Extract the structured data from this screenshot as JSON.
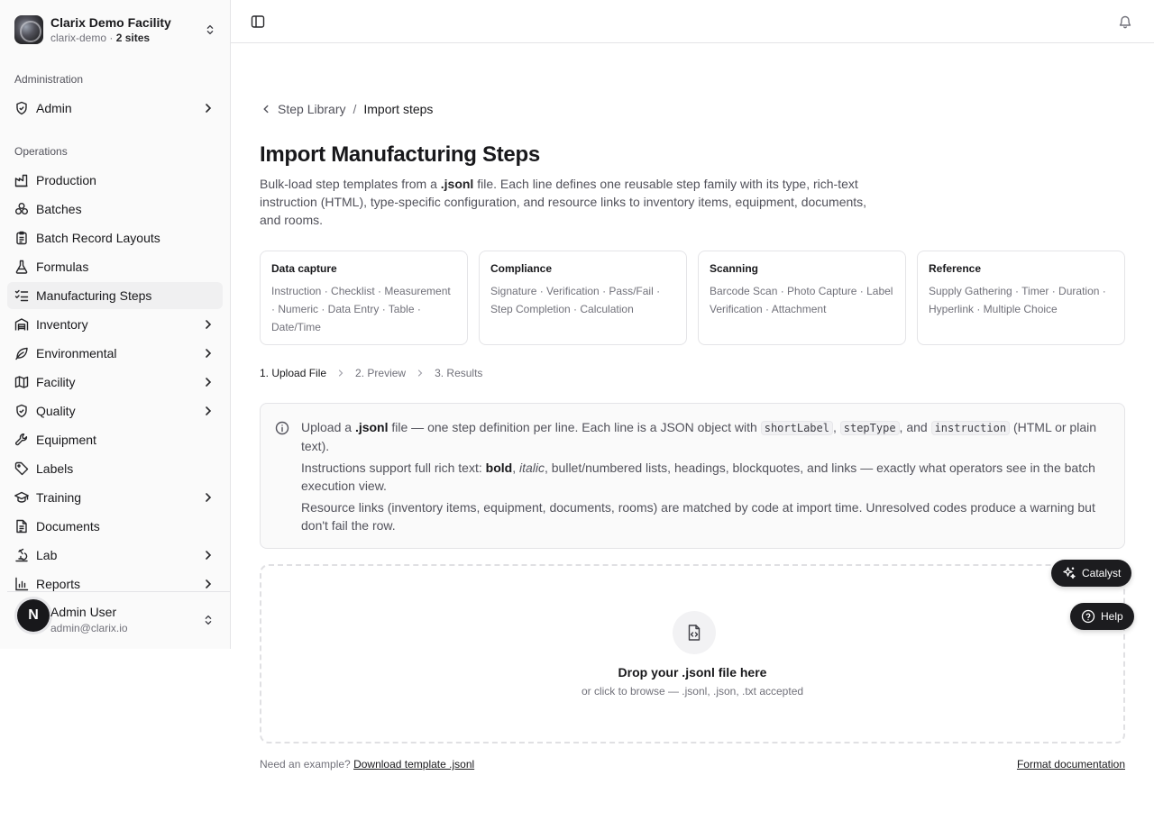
{
  "org": {
    "name": "Clarix Demo Facility",
    "slug": "clarix-demo",
    "sites": "2 sites"
  },
  "sidebar": {
    "admin_group": "Administration",
    "admin_item": "Admin",
    "ops_group": "Operations",
    "items": [
      {
        "label": "Production"
      },
      {
        "label": "Batches"
      },
      {
        "label": "Batch Record Layouts"
      },
      {
        "label": "Formulas"
      },
      {
        "label": "Manufacturing Steps"
      },
      {
        "label": "Inventory"
      },
      {
        "label": "Environmental"
      },
      {
        "label": "Facility"
      },
      {
        "label": "Quality"
      },
      {
        "label": "Equipment"
      },
      {
        "label": "Labels"
      },
      {
        "label": "Training"
      },
      {
        "label": "Documents"
      },
      {
        "label": "Lab"
      },
      {
        "label": "Reports"
      }
    ]
  },
  "user": {
    "initial": "N",
    "name": "Admin User",
    "email": "admin@clarix.io"
  },
  "breadcrumb": {
    "parent": "Step Library",
    "current": "Import steps"
  },
  "page": {
    "title": "Import Manufacturing Steps",
    "desc_1": "Bulk-load step templates from a ",
    "desc_ext": ".jsonl",
    "desc_2": " file. Each line defines one reusable step family with its type, rich-text instruction (HTML), type-specific configuration, and resource links to inventory items, equipment, documents, and rooms."
  },
  "cards": [
    {
      "title": "Data capture",
      "body": "Instruction · Checklist · Measurement · Numeric · Data Entry · Table · Date/Time"
    },
    {
      "title": "Compliance",
      "body": "Signature · Verification · Pass/Fail · Step Completion · Calculation"
    },
    {
      "title": "Scanning",
      "body": "Barcode Scan · Photo Capture · Label Verification · Attachment"
    },
    {
      "title": "Reference",
      "body": "Supply Gathering · Timer · Duration · Hyperlink · Multiple Choice"
    }
  ],
  "steps": [
    "1. Upload File",
    "2. Preview",
    "3. Results"
  ],
  "info": {
    "p1_a": "Upload a ",
    "p1_ext": ".jsonl",
    "p1_b": " file — one step definition per line. Each line is a JSON object with ",
    "code1": "shortLabel",
    "comma": ", ",
    "code2": "stepType",
    "and": ", and ",
    "code3": "instruction",
    "p1_c": " (HTML or plain text).",
    "p2_a": "Instructions support full rich text: ",
    "p2_bold": "bold",
    "p2_sep": ", ",
    "p2_italic": "italic",
    "p2_b": ", bullet/numbered lists, headings, blockquotes, and links — exactly what operators see in the batch execution view.",
    "p3": "Resource links (inventory items, equipment, documents, rooms) are matched by code at import time. Unresolved codes produce a warning but don't fail the row."
  },
  "dropzone": {
    "title": "Drop your .jsonl file here",
    "subtitle": "or click to browse — .jsonl, .json, .txt accepted"
  },
  "footer": {
    "prompt": "Need an example? ",
    "download": "Download template .jsonl",
    "docs": "Format documentation"
  },
  "fabs": {
    "catalyst": "Catalyst",
    "help": "Help"
  }
}
